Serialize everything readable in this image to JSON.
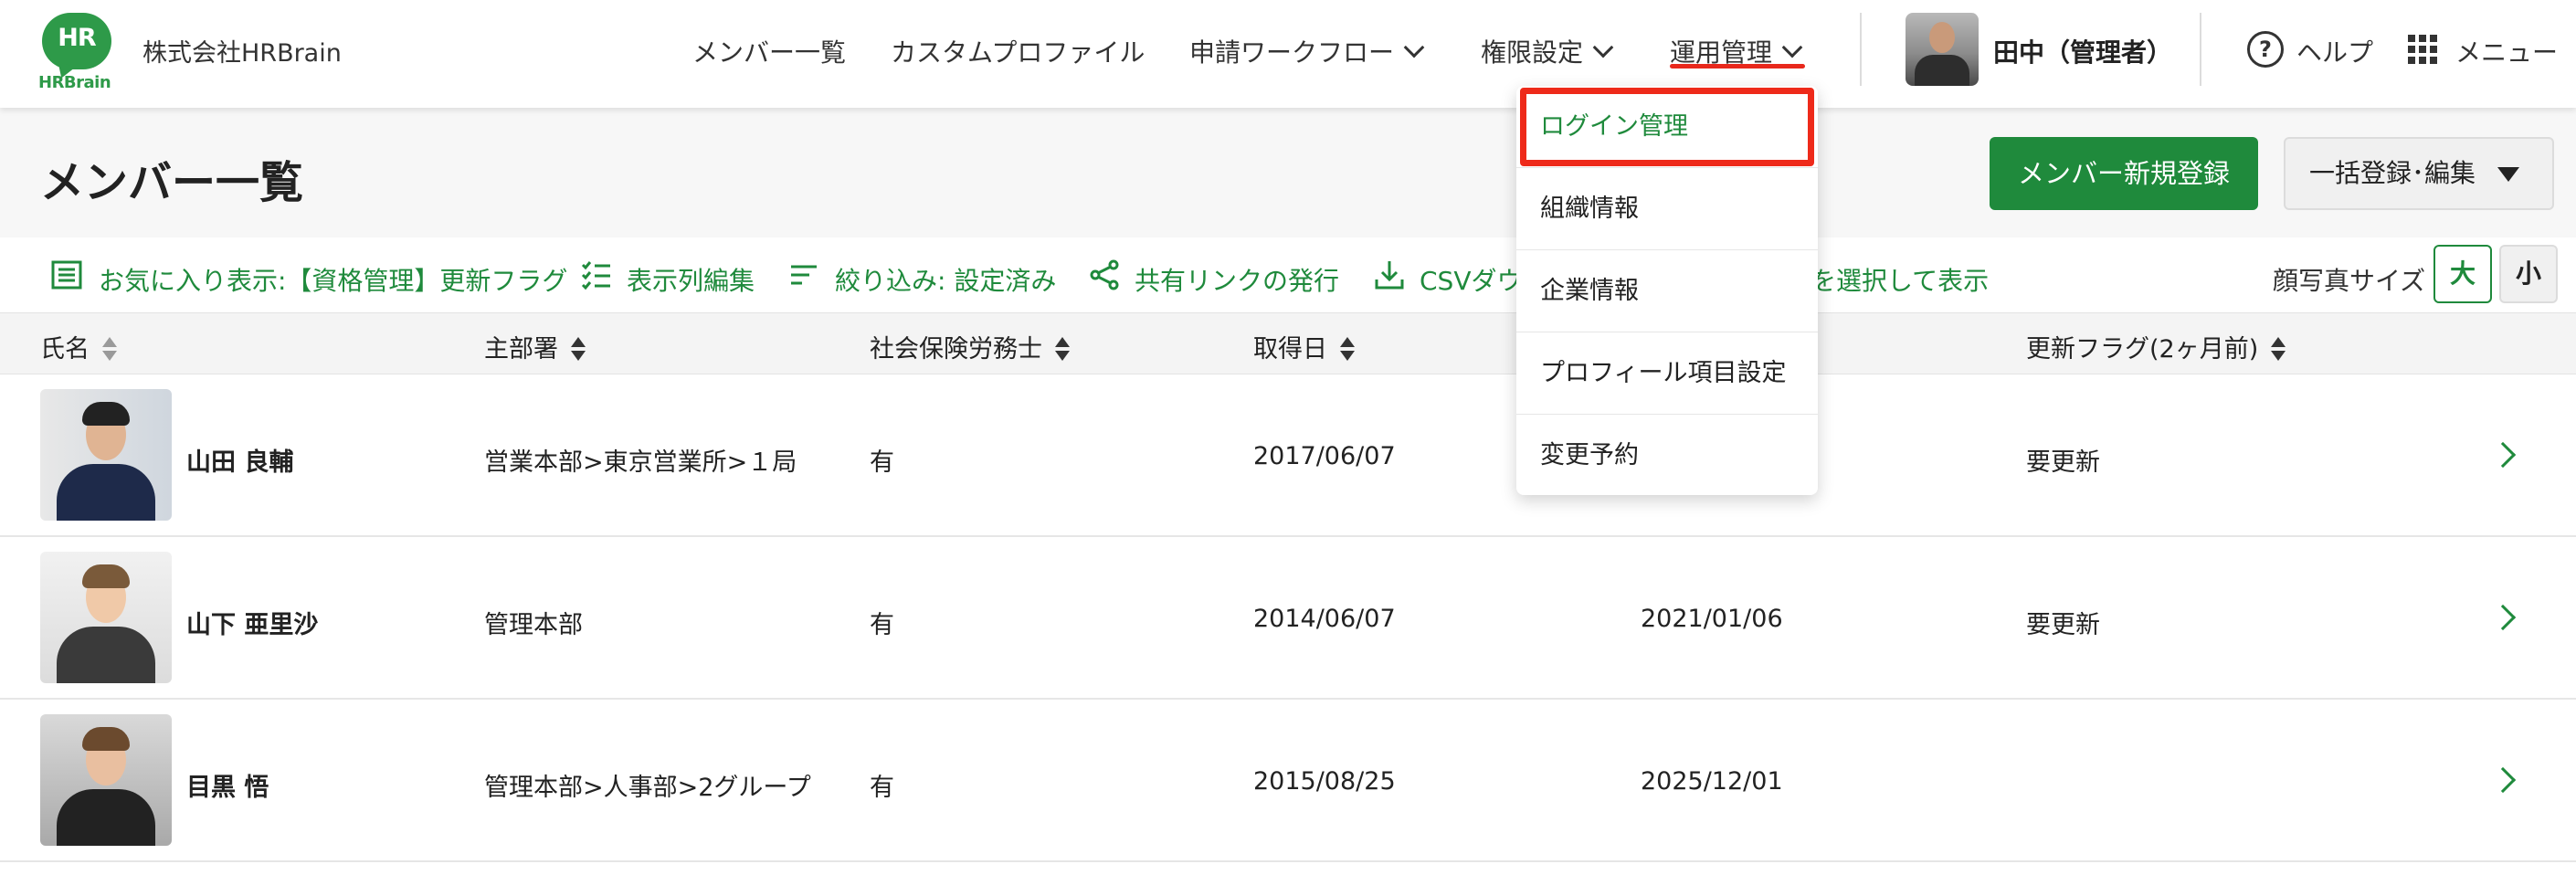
{
  "header": {
    "logo_text": "HR",
    "logo_brand": "HRBrain",
    "company": "株式会社HRBrain",
    "nav": [
      {
        "label": "メンバー一覧"
      },
      {
        "label": "カスタムプロファイル"
      },
      {
        "label": "申請ワークフロー"
      },
      {
        "label": "権限設定"
      },
      {
        "label": "運用管理"
      }
    ],
    "user_name": "田中（管理者）",
    "help_label": "ヘルプ",
    "menu_label": "メニュー"
  },
  "dropdown": {
    "items": [
      {
        "label": "ログイン管理"
      },
      {
        "label": "組織情報"
      },
      {
        "label": "企業情報"
      },
      {
        "label": "プロフィール項目設定"
      },
      {
        "label": "変更予約"
      }
    ]
  },
  "page": {
    "title": "メンバー一覧",
    "new_member_button": "メンバー新規登録",
    "bulk_button": "一括登録･編集"
  },
  "toolbar": {
    "favorite": "お気に入り表示:【資格管理】更新フラグ",
    "columns": "表示列編集",
    "filter": "絞り込み: 設定済み",
    "share": "共有リンクの発行",
    "csv": "CSVダウ",
    "select": "を選択して表示",
    "photo_size_label": "顔写真サイズ",
    "size_large": "大",
    "size_small": "小"
  },
  "table": {
    "columns": [
      {
        "label": "氏名"
      },
      {
        "label": "主部署"
      },
      {
        "label": "社会保険労務士"
      },
      {
        "label": "取得日"
      },
      {
        "label": "更新フラグ(2ヶ月前)"
      }
    ],
    "rows": [
      {
        "name": "山田 良輔",
        "dept": "営業本部>東京営業所>１局",
        "qualified": "有",
        "acquired": "2017/06/07",
        "date2": "",
        "flag": "要更新"
      },
      {
        "name": "山下 亜里沙",
        "dept": "管理本部",
        "qualified": "有",
        "acquired": "2014/06/07",
        "date2": "2021/01/06",
        "flag": "要更新"
      },
      {
        "name": "目黒 悟",
        "dept": "管理本部>人事部>2グループ",
        "qualified": "有",
        "acquired": "2015/08/25",
        "date2": "2025/12/01",
        "flag": ""
      }
    ]
  },
  "colors": {
    "brand_green": "#1f8a3c",
    "highlight_red": "#ee2a1a"
  }
}
